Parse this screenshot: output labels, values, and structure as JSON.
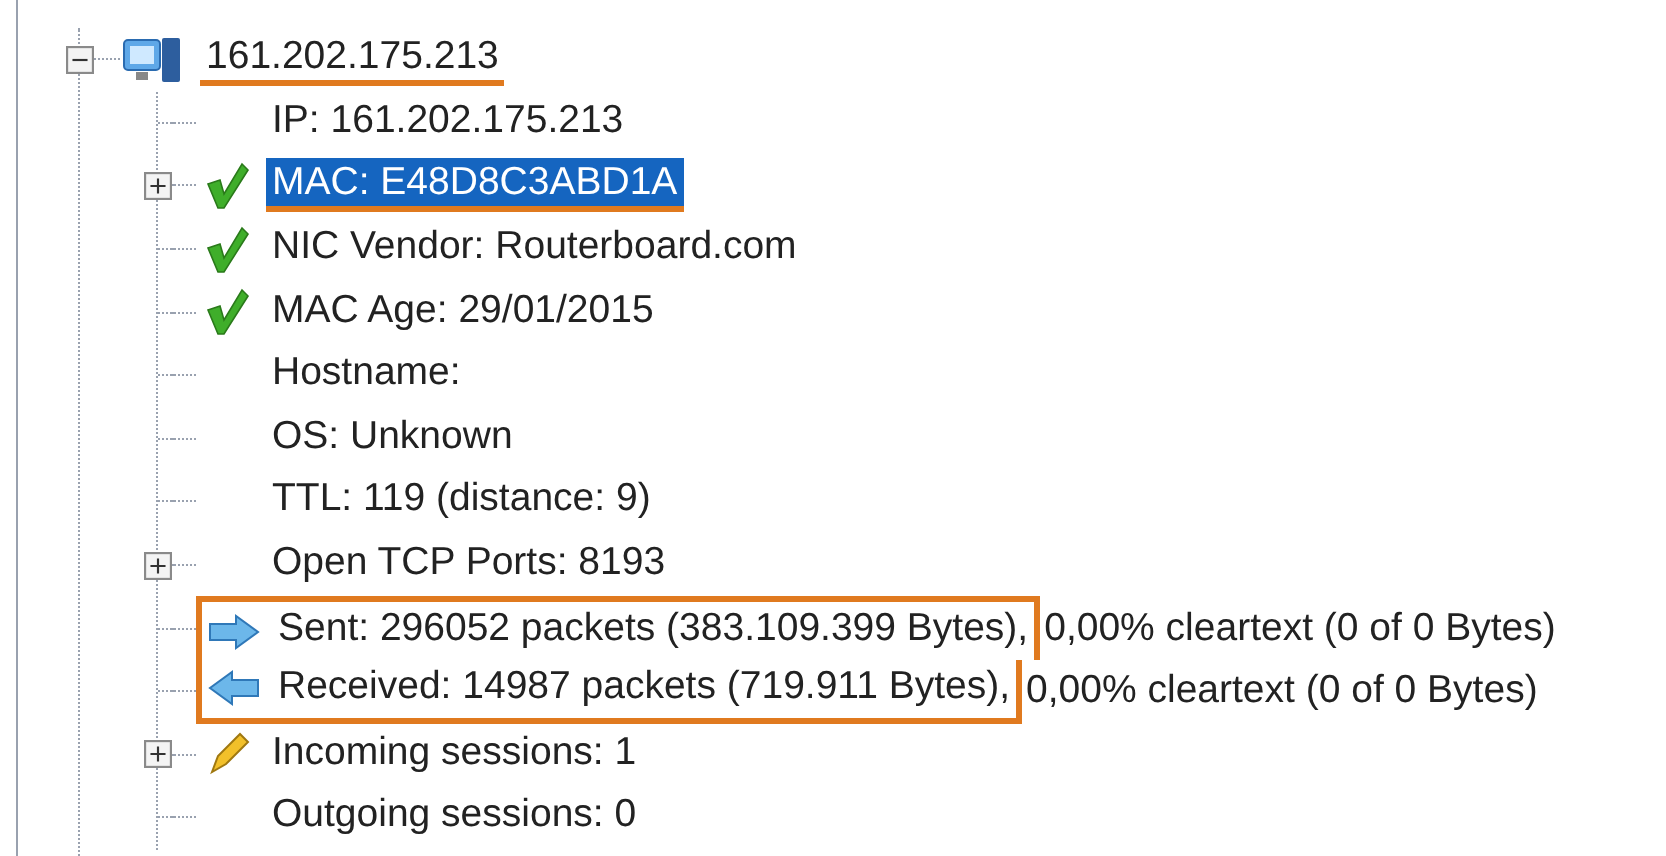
{
  "tree": {
    "label": "161.202.175.213",
    "kind": "computer",
    "expandable": true,
    "expanded": true,
    "selected": false,
    "underlined": true,
    "children": [
      {
        "label": "IP: 161.202.175.213",
        "kind": "plain",
        "expandable": false,
        "selected": false
      },
      {
        "label": "MAC: E48D8C3ABD1A",
        "kind": "check",
        "expandable": true,
        "expanded": false,
        "selected": true,
        "underlined": true
      },
      {
        "label": "NIC Vendor: Routerboard.com",
        "kind": "check",
        "expandable": false,
        "selected": false
      },
      {
        "label": "MAC Age: 29/01/2015",
        "kind": "check",
        "expandable": false,
        "selected": false
      },
      {
        "label": "Hostname:",
        "kind": "plain",
        "expandable": false,
        "selected": false
      },
      {
        "label": "OS: Unknown",
        "kind": "plain",
        "expandable": false,
        "selected": false
      },
      {
        "label": "TTL: 119 (distance: 9)",
        "kind": "plain",
        "expandable": false,
        "selected": false
      },
      {
        "label": "Open TCP Ports: 8193",
        "kind": "plain",
        "expandable": true,
        "expanded": false,
        "selected": false
      },
      {
        "label": "Sent: 296052 packets (383.109.399 Bytes),",
        "label_2": "0,00% cleartext (0 of 0 Bytes)",
        "kind": "sent",
        "expandable": false,
        "selected": false,
        "boxed": true
      },
      {
        "label": "Received: 14987 packets (719.911 Bytes),",
        "label_2": "0,00% cleartext (0 of 0 Bytes)",
        "kind": "received",
        "expandable": false,
        "selected": false,
        "boxed": true
      },
      {
        "label": "Incoming sessions: 1",
        "kind": "session",
        "expandable": true,
        "expanded": false,
        "selected": false
      },
      {
        "label": "Outgoing sessions: 0",
        "kind": "plain",
        "expandable": false,
        "selected": false
      }
    ]
  }
}
